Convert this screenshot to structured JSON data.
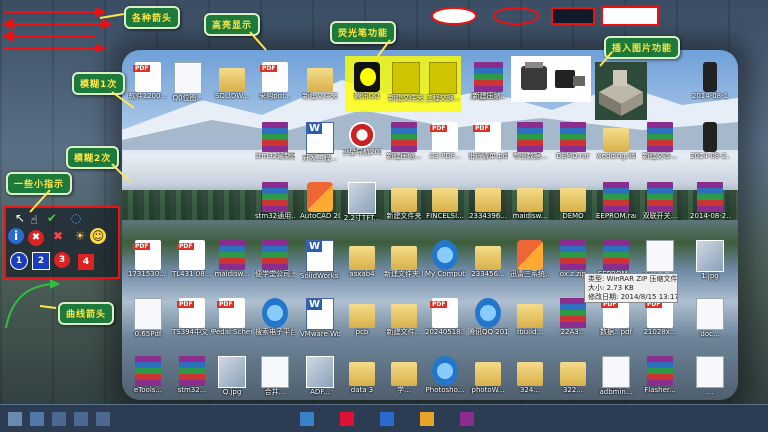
{
  "callouts": {
    "arrows": "各种箭头",
    "highlight": "高亮显示",
    "highlighter": "荧光笔功能",
    "insert_image": "插入图片功能",
    "blur1": "模糊1次",
    "blur2": "模糊2次",
    "pointer": "一些小指示",
    "curve_arrow": "曲线箭头"
  },
  "tooltip": {
    "type": "类型: WinRAR ZIP 压缩文件",
    "size": "大小: 2.73 KB",
    "modified": "修改日期: 2014/8/15 13:17"
  },
  "tool_badges": [
    "1",
    "2",
    "3",
    "4"
  ],
  "colors": {
    "accent_red": "#e11111",
    "callout_green": "#1e7a3a",
    "callout_text": "#ffe84a",
    "highlight_yellow": "#ffff00"
  },
  "icons": {
    "row1": [
      {
        "type": "pdf",
        "label": "软件1200..."
      },
      {
        "type": "doc",
        "label": "Q0位图..."
      },
      {
        "type": "folder",
        "label": "SOLIDW..."
      },
      {
        "type": "pdf",
        "label": "采购pdf..."
      },
      {
        "type": "folder",
        "label": "新建文件夹"
      },
      {
        "type": "qq",
        "label": "腾讯QQ"
      },
      {
        "type": "hlfolder",
        "label": "新建文件夹"
      },
      {
        "type": "hlfolder",
        "label": "工程交换..."
      },
      {
        "type": "rar",
        "label": "工程交换..."
      },
      {
        "type": "rar",
        "label": "新建压缩..."
      },
      {
        "type": "phone",
        "label": "2014-08-1"
      }
    ],
    "row2": [
      {
        "type": "rar",
        "label": "stm32最新固件..."
      },
      {
        "type": "word",
        "label": "开发工程..."
      },
      {
        "type": "app",
        "label": "卫星导航2014"
      },
      {
        "type": "rar",
        "label": "新建压缩..."
      },
      {
        "type": "pdf",
        "label": "A3 PDF..."
      },
      {
        "type": "pdf",
        "label": "出货清单.pdf"
      },
      {
        "type": "rar",
        "label": "专业数据..."
      },
      {
        "type": "rar",
        "label": "DEMO.rar"
      },
      {
        "type": "folder",
        "label": "wedding.list.ls"
      },
      {
        "type": "rar",
        "label": "新建文本..."
      },
      {
        "type": "phone",
        "label": "2014-08-2..."
      }
    ],
    "row3": [
      {
        "type": "rar",
        "label": "stm32通用..."
      },
      {
        "type": "exe",
        "label": "AutoCAD 2014"
      },
      {
        "type": "img",
        "label": "2.2寸TFT..."
      },
      {
        "type": "folder",
        "label": "新建文件夹"
      },
      {
        "type": "folder",
        "label": "FINCELSI..."
      },
      {
        "type": "folder",
        "label": "2334396..."
      },
      {
        "type": "folder",
        "label": "maidisw..."
      },
      {
        "type": "folder",
        "label": "DEMO"
      },
      {
        "type": "rar",
        "label": "EEPROM.rar"
      },
      {
        "type": "rar",
        "label": "双联开关..."
      },
      {
        "type": "rar",
        "label": "2014-08-2..."
      }
    ],
    "row4": [
      {
        "type": "pdf",
        "label": "1731530... (1).jpg"
      },
      {
        "type": "pdf",
        "label": "TL431 08... 文文档.pdf"
      },
      {
        "type": "rar",
        "label": "maidisw..."
      },
      {
        "type": "rar",
        "label": "便学堂公司 图片.jpg"
      },
      {
        "type": "word",
        "label": "SolidWorks 2014 x64"
      },
      {
        "type": "folder",
        "label": "asxab4"
      },
      {
        "type": "folder",
        "label": "新建文件夹 (3)"
      },
      {
        "type": "blue",
        "label": "My Computer"
      },
      {
        "type": "folder",
        "label": "233456..."
      },
      {
        "type": "exe",
        "label": "迅雷三系统..."
      },
      {
        "type": "rar",
        "label": "ox.z.zip"
      },
      {
        "type": "rar",
        "label": "EEPROM..."
      },
      {
        "type": "doc",
        "label": "文档显示..."
      },
      {
        "type": "img",
        "label": "1.jpg"
      }
    ],
    "row5": [
      {
        "type": "doc",
        "label": "0.65Pdf"
      },
      {
        "type": "pdf",
        "label": "TS394中文 版.pdf"
      },
      {
        "type": "pdf",
        "label": "Pedal Schematic..."
      },
      {
        "type": "blue",
        "label": "搜索电子平台..."
      },
      {
        "type": "word",
        "label": "VMware Workstation"
      },
      {
        "type": "folder",
        "label": "pcb"
      },
      {
        "type": "folder",
        "label": "新建文件..."
      },
      {
        "type": "pdf",
        "label": "20240518..."
      },
      {
        "type": "blue",
        "label": "腾讯QQ 2014"
      },
      {
        "type": "folder",
        "label": "fbuild..."
      },
      {
        "type": "rar",
        "label": "22A3..."
      },
      {
        "type": "pdf",
        "label": "数据...pdf"
      },
      {
        "type": "pdf",
        "label": "21028x..."
      },
      {
        "type": "doc",
        "label": "doc..."
      }
    ],
    "row6": [
      {
        "type": "rar",
        "label": "eTools..."
      },
      {
        "type": "rar",
        "label": "stm32..."
      },
      {
        "type": "img",
        "label": "Q.jpg"
      },
      {
        "type": "doc",
        "label": "合并..."
      },
      {
        "type": "img",
        "label": "ADF..."
      },
      {
        "type": "folder",
        "label": "data 3"
      },
      {
        "type": "folder",
        "label": "学..."
      },
      {
        "type": "blue",
        "label": "Photosho..."
      },
      {
        "type": "folder",
        "label": "photoW..."
      },
      {
        "type": "folder",
        "label": "324..."
      },
      {
        "type": "folder",
        "label": "322..."
      },
      {
        "type": "doc",
        "label": "adbmin..."
      },
      {
        "type": "rar",
        "label": "Flasher..."
      },
      {
        "type": "doc",
        "label": "..."
      }
    ]
  }
}
